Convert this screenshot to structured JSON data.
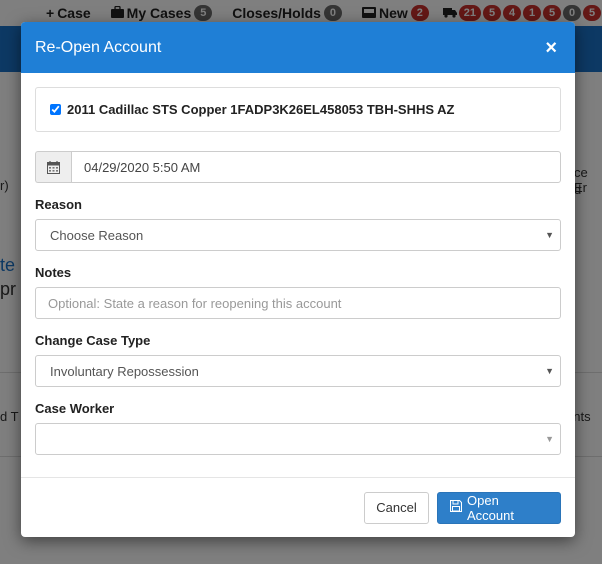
{
  "topbar": {
    "case_label": "Case",
    "my_cases_label": "My Cases",
    "my_cases_count": "5",
    "closes_holds_label": "Closes/Holds",
    "closes_holds_count": "0",
    "new_label": "New",
    "new_count": "2",
    "truck_counts": [
      "21",
      "5",
      "4",
      "1",
      "5",
      "0",
      "5"
    ]
  },
  "background": {
    "left_partial_1": "r)",
    "left_partial_2": "te",
    "left_partial_3": "pr",
    "left_partial_4": "d T",
    "right_partial_1": "ce Er",
    "right_partial_2": "d",
    "right_partial_3": "ents"
  },
  "modal": {
    "title": "Re-Open Account",
    "close_symbol": "×",
    "vehicle_label": "2011 Cadillac STS Copper 1FADP3K26EL458053 TBH-SHHS AZ",
    "vehicle_checked": true,
    "date_value": "04/29/2020 5:50 AM",
    "reason_label": "Reason",
    "reason_selected": "Choose Reason",
    "notes_label": "Notes",
    "notes_placeholder": "Optional: State a reason for reopening this account",
    "case_type_label": "Change Case Type",
    "case_type_selected": "Involuntary Repossession",
    "case_worker_label": "Case Worker",
    "case_worker_selected": "",
    "cancel_label": "Cancel",
    "open_label": "Open Account"
  },
  "colors": {
    "header_blue": "#1f7fd6",
    "primary_button": "#2e7fc9",
    "badge_red": "#c9302c",
    "badge_gray": "#6b6b6b"
  }
}
